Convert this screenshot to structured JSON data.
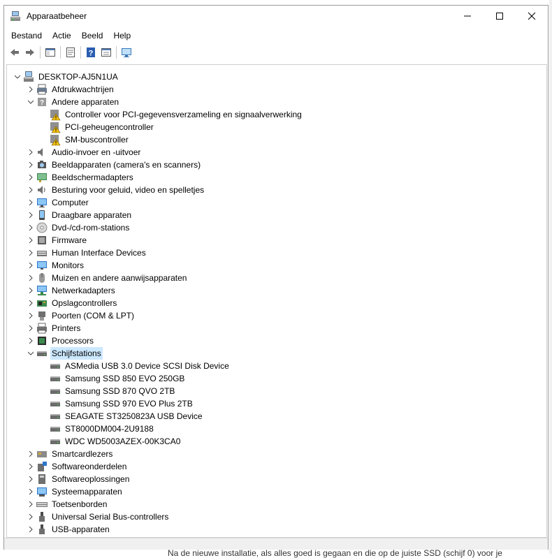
{
  "window": {
    "title": "Apparaatbeheer"
  },
  "menu": [
    "Bestand",
    "Actie",
    "Beeld",
    "Help"
  ],
  "toolbar": [
    "back-icon",
    "forward-icon",
    "show-hide-tree-icon",
    "properties-icon",
    "help-icon",
    "view-details-icon",
    "monitor-icon"
  ],
  "tree": {
    "root": "DESKTOP-AJ5N1UA",
    "nodes": [
      {
        "label": "Afdrukwachtrijen",
        "expanded": false,
        "icon": "print-queue-icon"
      },
      {
        "label": "Andere apparaten",
        "expanded": true,
        "icon": "other-devices-icon",
        "children": [
          "Controller voor PCI-gegevensverzameling en signaalverwerking",
          "PCI-geheugencontroller",
          "SM-buscontroller"
        ],
        "child_icon": "warning-device-icon"
      },
      {
        "label": "Audio-invoer en -uitvoer",
        "expanded": false,
        "icon": "speaker-icon"
      },
      {
        "label": "Beeldapparaten (camera's en scanners)",
        "expanded": false,
        "icon": "camera-icon"
      },
      {
        "label": "Beeldschermadapters",
        "expanded": false,
        "icon": "display-adapter-icon"
      },
      {
        "label": "Besturing voor geluid, video en spelletjes",
        "expanded": false,
        "icon": "sound-icon"
      },
      {
        "label": "Computer",
        "expanded": false,
        "icon": "computer-icon"
      },
      {
        "label": "Draagbare apparaten",
        "expanded": false,
        "icon": "portable-device-icon"
      },
      {
        "label": "Dvd-/cd-rom-stations",
        "expanded": false,
        "icon": "dvd-icon"
      },
      {
        "label": "Firmware",
        "expanded": false,
        "icon": "firmware-icon"
      },
      {
        "label": "Human Interface Devices",
        "expanded": false,
        "icon": "hid-icon"
      },
      {
        "label": "Monitors",
        "expanded": false,
        "icon": "monitor-icon"
      },
      {
        "label": "Muizen en andere aanwijsapparaten",
        "expanded": false,
        "icon": "mouse-icon"
      },
      {
        "label": "Netwerkadapters",
        "expanded": false,
        "icon": "network-icon"
      },
      {
        "label": "Opslagcontrollers",
        "expanded": false,
        "icon": "storage-controller-icon"
      },
      {
        "label": "Poorten (COM & LPT)",
        "expanded": false,
        "icon": "port-icon"
      },
      {
        "label": "Printers",
        "expanded": false,
        "icon": "printer-icon"
      },
      {
        "label": "Processors",
        "expanded": false,
        "icon": "processor-icon"
      },
      {
        "label": "Schijfstations",
        "expanded": true,
        "selected": true,
        "icon": "disk-drive-icon",
        "children": [
          "ASMedia USB 3.0 Device SCSI Disk Device",
          "Samsung SSD 850 EVO 250GB",
          "Samsung SSD 870 QVO 2TB",
          "Samsung SSD 970 EVO Plus 2TB",
          "SEAGATE ST3250823A USB Device",
          "ST8000DM004-2U9188",
          "WDC WD5003AZEX-00K3CA0"
        ],
        "child_icon": "disk-drive-icon"
      },
      {
        "label": "Smartcardlezers",
        "expanded": false,
        "icon": "smartcard-icon"
      },
      {
        "label": "Softwareonderdelen",
        "expanded": false,
        "icon": "software-component-icon"
      },
      {
        "label": "Softwareoplossingen",
        "expanded": false,
        "icon": "software-device-icon"
      },
      {
        "label": "Systeemapparaten",
        "expanded": false,
        "icon": "system-device-icon"
      },
      {
        "label": "Toetsenborden",
        "expanded": false,
        "icon": "keyboard-icon"
      },
      {
        "label": "Universal Serial Bus-controllers",
        "expanded": false,
        "icon": "usb-icon"
      },
      {
        "label": "USB-apparaten",
        "expanded": false,
        "icon": "usb-device-icon"
      }
    ]
  },
  "background_text": "Na de nieuwe installatie, als alles goed is gegaan en die op de juiste SSD (schijf 0) voor je"
}
